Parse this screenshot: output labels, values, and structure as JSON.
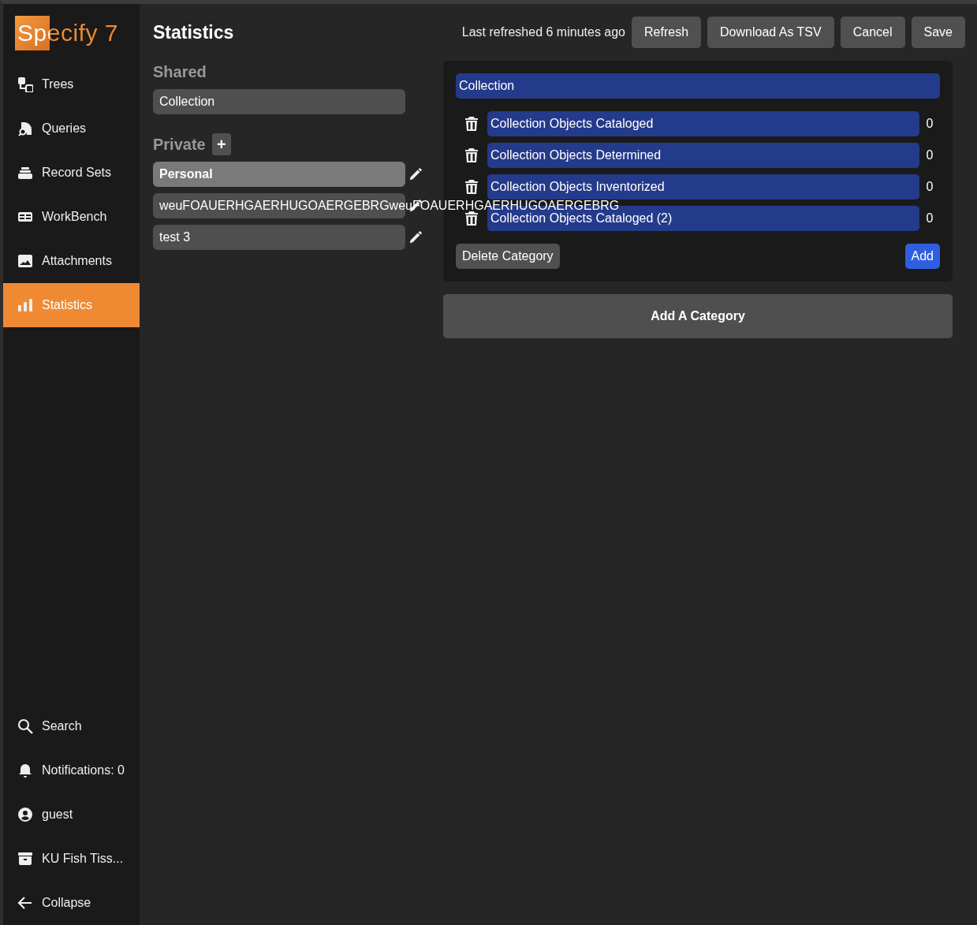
{
  "sidebar": {
    "logo": "Specify 7",
    "items": [
      {
        "kind": "trees",
        "label": "Trees",
        "selected": false
      },
      {
        "kind": "queries",
        "label": "Queries",
        "selected": false
      },
      {
        "kind": "recordsets",
        "label": "Record Sets",
        "selected": false
      },
      {
        "kind": "workbench",
        "label": "WorkBench",
        "selected": false
      },
      {
        "kind": "attachments",
        "label": "Attachments",
        "selected": false
      },
      {
        "kind": "statistics",
        "label": "Statistics",
        "selected": true
      }
    ],
    "bottom_items": [
      {
        "kind": "search",
        "label": "Search"
      },
      {
        "kind": "bell",
        "label": "Notifications: 0"
      },
      {
        "kind": "user",
        "label": "guest"
      },
      {
        "kind": "archive",
        "label": "KU Fish Tiss..."
      },
      {
        "kind": "back",
        "label": "Collapse"
      }
    ]
  },
  "header": {
    "title": "Statistics",
    "refreshed": "Last refreshed 6 minutes ago",
    "buttons": [
      "Refresh",
      "Download As TSV",
      "Cancel",
      "Save"
    ]
  },
  "pages": {
    "shared": {
      "heading": "Shared",
      "items": [
        {
          "label": "Collection",
          "selected": false
        }
      ]
    },
    "private": {
      "heading": "Private",
      "add": "+",
      "items": [
        {
          "label": "Personal",
          "selected": true
        },
        {
          "label": "weuFOAUERHGAERHUGOAERGEBRGweuFOAUERHGAERHUGOAERGEBRG",
          "selected": false
        },
        {
          "label": "test 3",
          "selected": false
        }
      ]
    }
  },
  "category": {
    "name": "Collection",
    "items": [
      {
        "label": "Collection Objects Cataloged",
        "value": "0"
      },
      {
        "label": "Collection Objects Determined",
        "value": "0"
      },
      {
        "label": "Collection Objects Inventorized",
        "value": "0"
      },
      {
        "label": "Collection Objects Cataloged (2)",
        "value": "0"
      }
    ],
    "delete": "Delete Category",
    "add": "Add"
  },
  "add_category": "Add A Category"
}
